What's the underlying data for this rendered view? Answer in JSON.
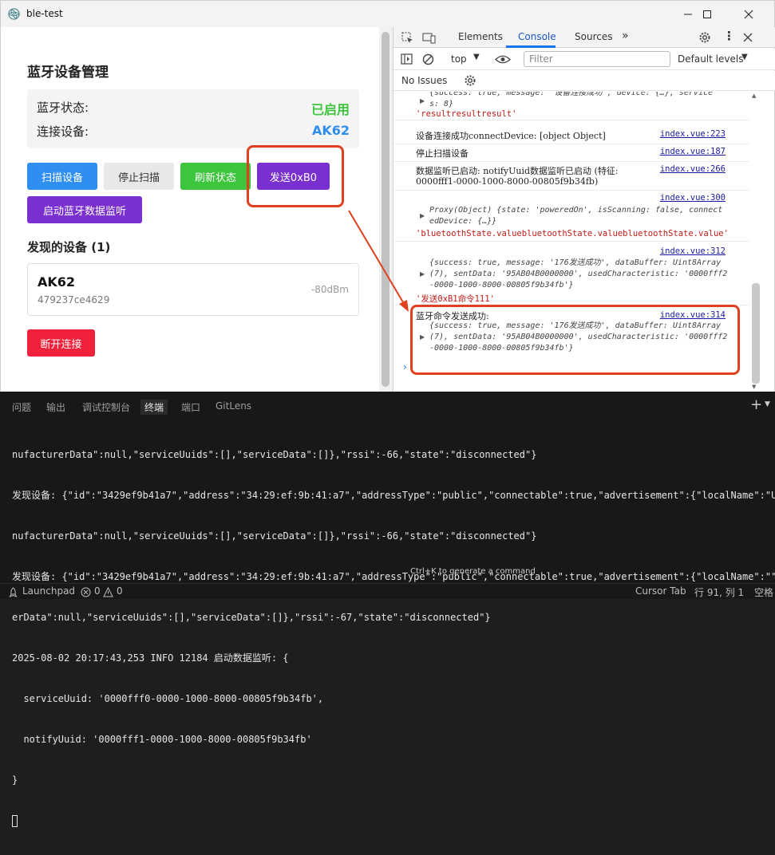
{
  "window": {
    "title": "ble-test"
  },
  "app": {
    "page_title": "蓝牙设备管理",
    "bt_status_label": "蓝牙状态:",
    "bt_status_value": "已启用",
    "connected_label": "连接设备:",
    "connected_value": "AK62",
    "buttons": {
      "scan": "扫描设备",
      "stop_scan": "停止扫描",
      "refresh": "刷新状态",
      "send": "发送0xB0",
      "start_monitor": "启动蓝牙数据监听",
      "disconnect": "断开连接"
    },
    "found_title": "发现的设备 (1)",
    "device": {
      "name": "AK62",
      "id": "479237ce4629",
      "rssi": "-80dBm"
    }
  },
  "devtools": {
    "tabs": [
      "Elements",
      "Console",
      "Sources"
    ],
    "context": "top",
    "filter_placeholder": "Filter",
    "levels": "Default levels",
    "no_issues": "No Issues",
    "console": {
      "m0_obj": "{success: true, message: '设备连接成功', device: {…}, service",
      "m0_obj2": "s: 8}",
      "m0_str": "'resultresultresult'",
      "m1_text": "设备连接成功connectDevice: [object Object]",
      "m1_src": "index.vue:223",
      "m2_text": "停止扫描设备",
      "m2_src": "index.vue:187",
      "m3_text": "数据监听已启动: notifyUuid数据监听已启动 (特征:",
      "m3_text2": "0000fff1-0000-1000-8000-00805f9b34fb)",
      "m3_src": "index.vue:266",
      "m4_src": "index.vue:300",
      "m4_obj": "Proxy(Object) {state: 'poweredOn', isScanning: false, connect",
      "m4_obj2": "edDevice: {…}}",
      "m4_str": "'bluetoothState.valuebluetoothState.valuebluetoothState.value'",
      "m5_src": "index.vue:312",
      "m5_obj": "{success: true, message: '176发送成功', dataBuffer: Uint8Array",
      "m5_obj2": "(7), sentData: '95AB04B0000000', usedCharacteristic: '0000fff2",
      "m5_obj3": "-0000-1000-8000-00805f9b34fb'}",
      "m5_str": "'发送0xB1命令111'",
      "m6_text": "蓝牙命令发送成功:",
      "m6_src": "index.vue:314",
      "m6_obj": "{success: true, message: '176发送成功', dataBuffer: Uint8Array",
      "m6_obj2": "(7), sentData: '95AB04B0000000', usedCharacteristic: '0000fff2",
      "m6_obj3": "-0000-1000-8000-00805f9b34fb'}"
    }
  },
  "panel": {
    "tabs": [
      "问题",
      "输出",
      "调试控制台",
      "终端",
      "端口",
      "GitLens"
    ],
    "active_tab": "终端",
    "terminal_lines": [
      "nufacturerData\":null,\"serviceUuids\":[],\"serviceData\":[]},\"rssi\":-66,\"state\":\"disconnected\"}",
      "发现设备: {\"id\":\"3429ef9b41a7\",\"address\":\"34:29:ef:9b:41:a7\",\"addressType\":\"public\",\"connectable\":true,\"advertisement\":{\"localName\":\"U-DW",
      "nufacturerData\":null,\"serviceUuids\":[],\"serviceData\":[]},\"rssi\":-66,\"state\":\"disconnected\"}",
      "发现设备: {\"id\":\"3429ef9b41a7\",\"address\":\"34:29:ef:9b:41:a7\",\"addressType\":\"public\",\"connectable\":true,\"advertisement\":{\"localName\":\"\",\"t",
      "erData\":null,\"serviceUuids\":[],\"serviceData\":[]},\"rssi\":-67,\"state\":\"disconnected\"}",
      "2025-08-02 20:17:43,253 INFO 12184 启动数据监听: {",
      "  serviceUuid: '0000fff0-0000-1000-8000-00805f9b34fb',",
      "  notifyUuid: '0000fff1-0000-1000-8000-00805f9b34fb'",
      "}"
    ],
    "hint": "Ctrl+K to generate a command"
  },
  "statusbar": {
    "launchpad": "Launchpad",
    "errors": "0",
    "warnings": "0",
    "cursor_tab": "Cursor Tab",
    "position": "行 91, 列 1",
    "spaces": "空格"
  }
}
